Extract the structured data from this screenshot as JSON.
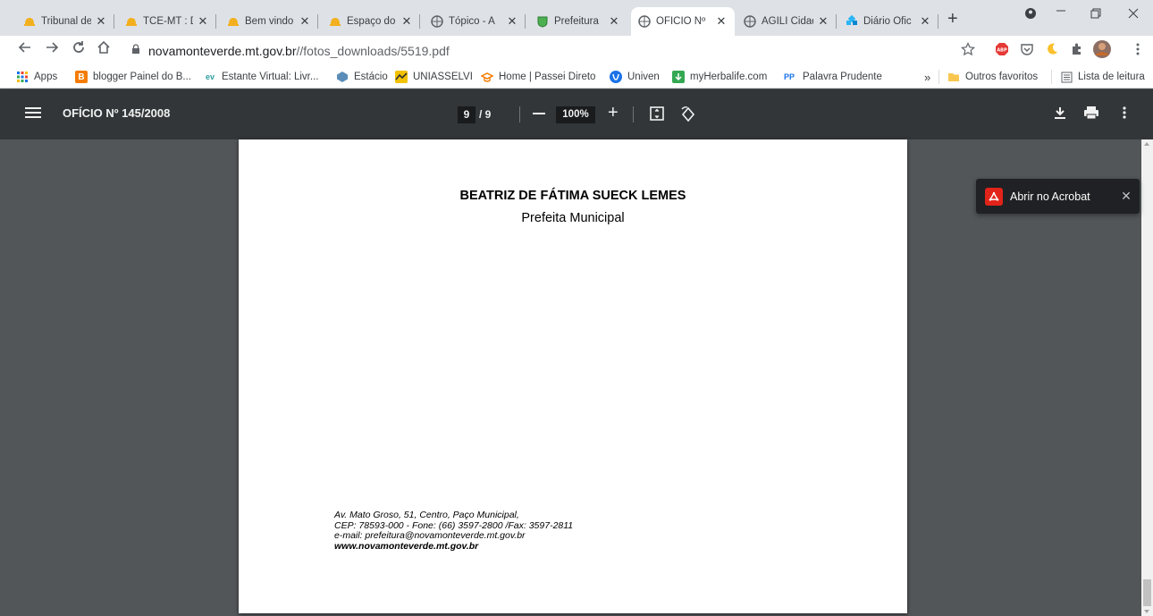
{
  "tabs": [
    {
      "title": "Tribunal de",
      "icon": "helmet-icon",
      "active": false
    },
    {
      "title": "TCE-MT : D",
      "icon": "helmet-icon",
      "active": false
    },
    {
      "title": "Bem vindo",
      "icon": "helmet-icon",
      "active": false
    },
    {
      "title": "Espaço do",
      "icon": "helmet-icon",
      "active": false
    },
    {
      "title": "Tópico - A",
      "icon": "globe-icon",
      "active": false
    },
    {
      "title": "Prefeitura",
      "icon": "crest-icon",
      "active": false
    },
    {
      "title": "OFÍCIO Nº",
      "icon": "globe-icon",
      "active": true
    },
    {
      "title": "ÁGILI Cidad",
      "icon": "globe-icon",
      "active": false
    },
    {
      "title": "Diário Ofic",
      "icon": "diamond-icon",
      "active": false
    }
  ],
  "tab_close_glyph": "✕",
  "new_tab_glyph": "+",
  "address": {
    "domain": "novamonteverde.mt.gov.br",
    "path": "//fotos_downloads/5519.pdf"
  },
  "bookmarks": [
    {
      "label": "Apps",
      "icon": "apps-grid-icon"
    },
    {
      "label": "blogger Painel do B...",
      "icon": "blogger-icon",
      "color": "#f57c00"
    },
    {
      "label": "Estante Virtual: Livr...",
      "icon": "ev-icon",
      "color": "#2f9e9e"
    },
    {
      "label": "Estácio",
      "icon": "estacio-icon",
      "color": "#5b8db8"
    },
    {
      "label": "UNIASSELVI",
      "icon": "uniasselvi-icon",
      "color": "#f2c200"
    },
    {
      "label": "Home | Passei Direto",
      "icon": "passei-direto-icon",
      "color": "#f57c00"
    },
    {
      "label": "Univen",
      "icon": "univen-icon",
      "color": "#1a73e8"
    },
    {
      "label": "myHerbalife.com",
      "icon": "herbalife-icon",
      "color": "#34a853"
    },
    {
      "label": "Palavra Prudente",
      "icon": "pp-icon",
      "color": "#1a73e8"
    }
  ],
  "bookmarks_overflow": "»",
  "bookmark_folder": {
    "label": "Outros favoritos",
    "icon": "folder-icon"
  },
  "reading_list": {
    "label": "Lista de leitura",
    "icon": "reading-list-icon"
  },
  "pdf": {
    "title": "OFÍCIO Nº 145/2008",
    "current_page": "9",
    "total_pages": "/ 9",
    "zoom": "100%"
  },
  "document": {
    "signer_name": "BEATRIZ DE FÁTIMA SUECK LEMES",
    "signer_role": "Prefeita Municipal",
    "footer_lines": [
      "Av. Mato Groso, 51, Centro, Paço Municipal,",
      "CEP: 78593-000 - Fone: (66) 3597-2800 /Fax: 3597-2811",
      "e-mail: prefeitura@novamonteverde.mt.gov.br"
    ],
    "footer_web": "www.novamonteverde.mt.gov.br"
  },
  "acrobat_popup": {
    "label": "Abrir no Acrobat",
    "icon": "acrobat-icon",
    "close_glyph": "✕",
    "color": "#e2231a"
  },
  "theme": {
    "pdf_toolbar": "#323639",
    "viewer_bg": "#525659",
    "tabstrip_bg": "#dee1e6"
  }
}
